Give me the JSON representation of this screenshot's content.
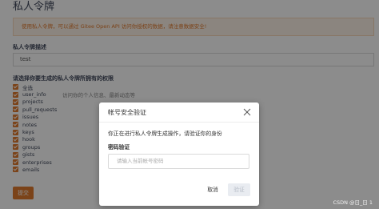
{
  "page": {
    "title": "私人令牌",
    "warning": "使用私人令牌，可以通过 Gitee Open API 访问你授权的数据，请注意数据安全!",
    "description_label": "私人令牌描述",
    "description_value": "test",
    "permissions_label": "请选择你要生成的私人令牌所拥有的权限",
    "permissions": [
      {
        "name": "全选",
        "desc": ""
      },
      {
        "name": "user_info",
        "desc": "访问你的个人信息、最新动态等"
      },
      {
        "name": "projects",
        "desc": ""
      },
      {
        "name": "pull_requests",
        "desc": ""
      },
      {
        "name": "issues",
        "desc": ""
      },
      {
        "name": "notes",
        "desc": ""
      },
      {
        "name": "keys",
        "desc": ""
      },
      {
        "name": "hook",
        "desc": ""
      },
      {
        "name": "groups",
        "desc": ""
      },
      {
        "name": "gists",
        "desc": ""
      },
      {
        "name": "enterprises",
        "desc": ""
      },
      {
        "name": "emails",
        "desc": ""
      }
    ],
    "submit_label": "提交"
  },
  "modal": {
    "title": "帐号安全验证",
    "message": "你正在进行私人令牌生成操作，请验证你的身份",
    "password_label": "密码验证",
    "password_placeholder": "请输入当前帐号密码",
    "cancel_label": "取消",
    "confirm_label": "验证"
  },
  "watermark": "CSDN @ㄖ_ㄖ 1",
  "colors": {
    "accent": "#e07a2e",
    "overlay": "rgba(0,0,0,0.45)"
  }
}
